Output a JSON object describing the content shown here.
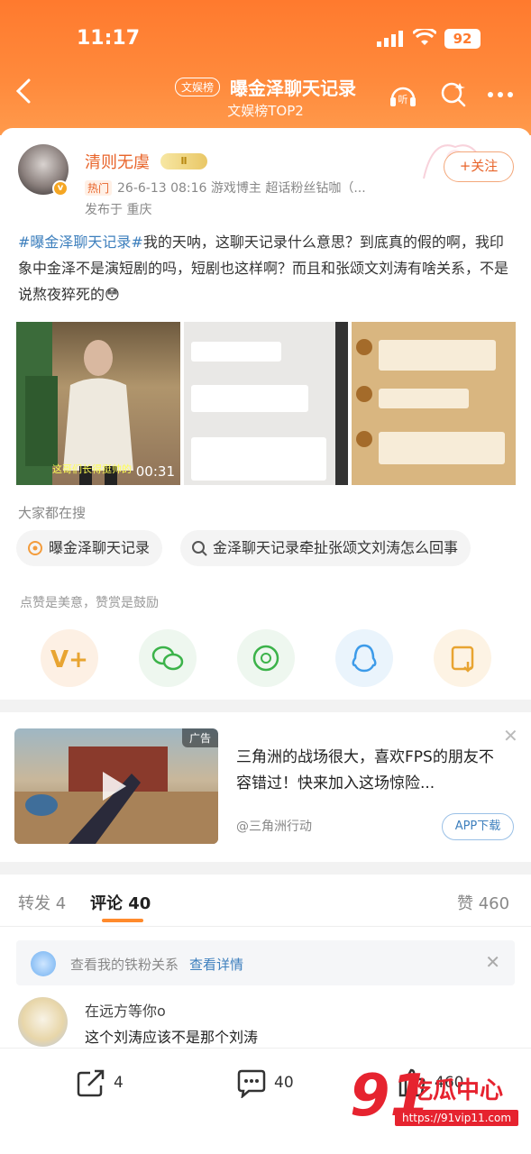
{
  "status": {
    "time": "11:17",
    "battery": "92"
  },
  "nav": {
    "tag": "文娱榜",
    "title": "曝金泽聊天记录",
    "subtitle": "文娱榜TOP2"
  },
  "post": {
    "author": "清则无虞",
    "hot_badge": "热门",
    "meta": "26-6-13 08:16  游戏博主 超话粉丝钻咖（...",
    "location": "发布于 重庆",
    "follow_label": "+关注",
    "topic": "#曝金泽聊天记录#",
    "body": "我的天呐，这聊天记录什么意思？到底真的假的啊，我印象中金泽不是演短剧的吗，短剧也这样啊？而且和张颂文刘涛有啥关系，不是说熬夜猝死的😳",
    "video_duration": "00:31",
    "video_caption": "这哥们长得挺帅的"
  },
  "search": {
    "label": "大家都在搜",
    "items": [
      "曝金泽聊天记录",
      "金泽聊天记录牵扯张颂文刘涛怎么回事"
    ]
  },
  "praise_text": "点赞是美意，赞赏是鼓励",
  "share_icons": [
    "weibo-reward-icon",
    "wechat-icon",
    "moments-icon",
    "qq-icon",
    "save-image-icon"
  ],
  "ad": {
    "tag": "广告",
    "text": "三角洲的战场很大，喜欢FPS的朋友不容错过！快来加入这场惊险...",
    "source": "@三角洲行动",
    "button": "APP下载"
  },
  "tabs": {
    "repost": "转发 4",
    "comment": "评论 40",
    "like": "赞 460"
  },
  "iron_fan": {
    "text": "查看我的铁粉关系",
    "link": "查看详情"
  },
  "comment": {
    "name": "在远方等你o",
    "text": "这个刘涛应该不是那个刘涛"
  },
  "bottom": {
    "repost": "4",
    "comment": "40",
    "like": "460"
  },
  "watermark": {
    "num": "91",
    "text": "吃瓜中心",
    "url": "https://91vip11.com"
  },
  "colors": {
    "header": "#ff7a2e",
    "accent": "#e8642a",
    "link": "#3d7fbd"
  }
}
